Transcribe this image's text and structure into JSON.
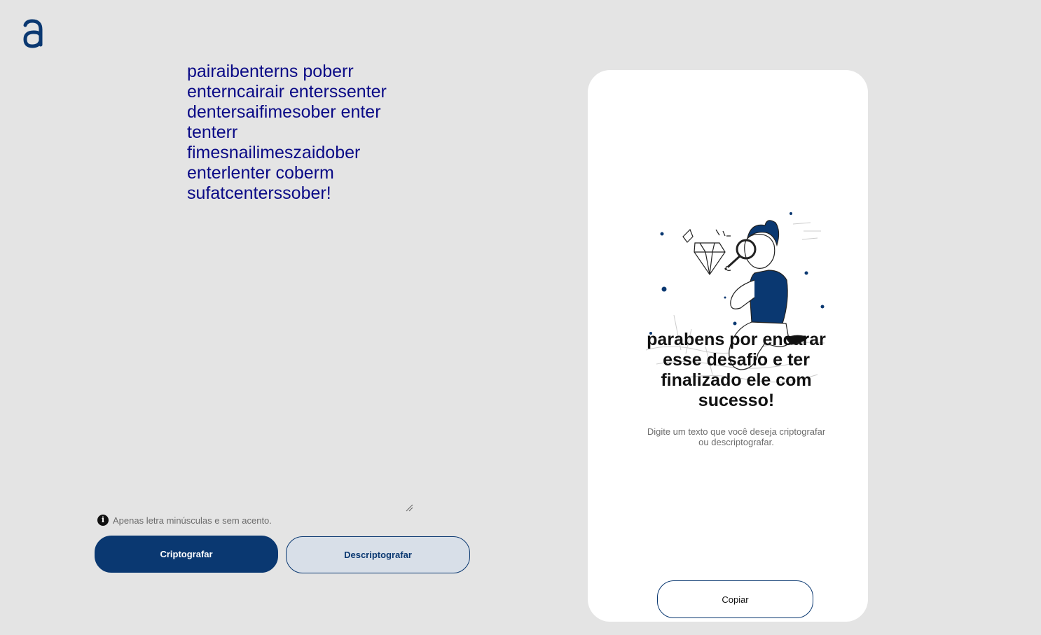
{
  "header": {
    "logo_icon": "alura-logo-icon"
  },
  "input": {
    "value": "pairaibenterns poberr enterncairair enterssenter dentersaifimesober enter tenterr fimesnailimeszaidober enterlenter coberm sufatcenterssober!"
  },
  "hint": {
    "icon": "info-icon",
    "text": "Apenas letra minúsculas e sem acento."
  },
  "actions": {
    "encrypt_label": "Criptografar",
    "decrypt_label": "Descriptografar"
  },
  "output_card": {
    "illustration": "person-with-magnifier-and-diamond-illustration",
    "title": "parabens por encarar esse desafio e ter finalizado ele com sucesso!",
    "subtitle": "Digite um texto que você deseja criptografar ou descriptografar.",
    "copy_label": "Copiar"
  },
  "colors": {
    "background": "#e4e4e4",
    "primary": "#0a3871",
    "secondary_bg": "#d8dfe8",
    "input_text": "#0a0a86",
    "card_bg": "#ffffff"
  }
}
